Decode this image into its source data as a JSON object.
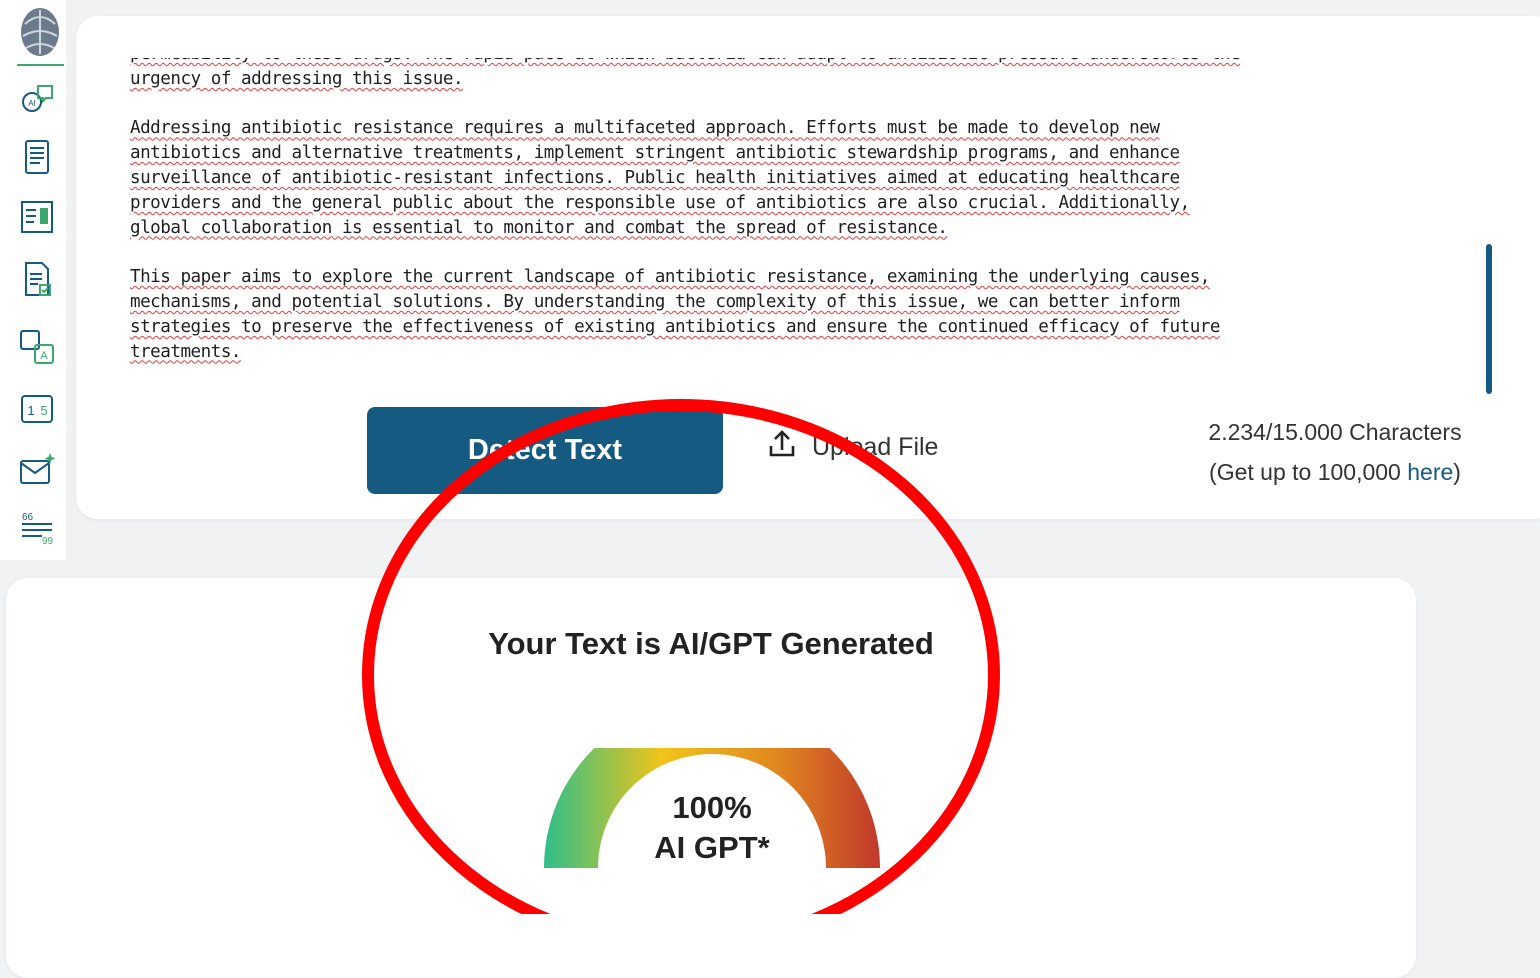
{
  "sidebar": {
    "icons": [
      "brain-logo-icon",
      "ai-chat-icon",
      "document-list-icon",
      "image-text-icon",
      "document-check-icon",
      "translate-icon",
      "number-convert-icon",
      "email-sparkle-icon",
      "quote-icon"
    ],
    "accent_color": "#3aa76d"
  },
  "editor": {
    "paragraphs": [
      "permeability to these drugs. The rapid pace at which bacteria can adapt to antibiotic pressure underscores the\nurgency of addressing this issue.",
      "Addressing antibiotic resistance requires a multifaceted approach. Efforts must be made to develop new\nantibiotics and alternative treatments, implement stringent antibiotic stewardship programs, and enhance\nsurveillance of antibiotic-resistant infections. Public health initiatives aimed at educating healthcare\nproviders and the general public about the responsible use of antibiotics are also crucial. Additionally,\nglobal collaboration is essential to monitor and combat the spread of resistance.",
      "This paper aims to explore the current landscape of antibiotic resistance, examining the underlying causes,\nmechanisms, and potential solutions. By understanding the complexity of this issue, we can better inform\nstrategies to preserve the effectiveness of existing antibiotics and ensure the continued efficacy of future\ntreatments."
    ]
  },
  "actions": {
    "detect_label": "Detect Text",
    "upload_label": "Upload File",
    "char_count": "2.234/15.000 Characters",
    "upgrade_prefix": "(Get up to 100,000 ",
    "upgrade_link": "here",
    "upgrade_suffix": ")",
    "primary_color": "#155a80"
  },
  "result": {
    "title": "Your Text is AI/GPT Generated",
    "percent_label": "100%",
    "type_label": "AI GPT*",
    "ai_fraction": 1.0,
    "gauge_colors": [
      "#2ebf8a",
      "#f0c419",
      "#e0851f",
      "#c0392b"
    ]
  },
  "annotation": {
    "color": "#ff0000"
  }
}
